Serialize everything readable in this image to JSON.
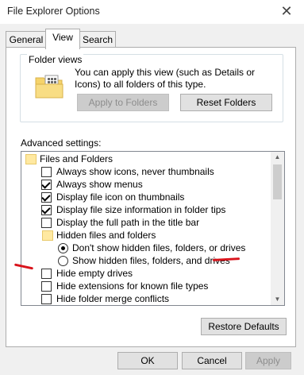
{
  "window": {
    "title": "File Explorer Options",
    "close_symbol": "✕"
  },
  "tabs": [
    {
      "label": "General",
      "selected": false
    },
    {
      "label": "View",
      "selected": true
    },
    {
      "label": "Search",
      "selected": false
    }
  ],
  "folder_views": {
    "group_label": "Folder views",
    "description": "You can apply this view (such as Details or Icons) to all folders of this type.",
    "apply_button": "Apply to Folders",
    "reset_button": "Reset Folders",
    "icon": "folder-view-icon"
  },
  "advanced": {
    "label": "Advanced settings:",
    "items": [
      {
        "type": "folder",
        "label": "Files and Folders"
      },
      {
        "type": "checkbox",
        "label": "Always show icons, never thumbnails",
        "checked": false
      },
      {
        "type": "checkbox",
        "label": "Always show menus",
        "checked": true
      },
      {
        "type": "checkbox",
        "label": "Display file icon on thumbnails",
        "checked": true
      },
      {
        "type": "checkbox",
        "label": "Display file size information in folder tips",
        "checked": true
      },
      {
        "type": "checkbox",
        "label": "Display the full path in the title bar",
        "checked": false
      },
      {
        "type": "folder",
        "label": "Hidden files and folders"
      },
      {
        "type": "radio",
        "label": "Don't show hidden files, folders, or drives",
        "selected": true
      },
      {
        "type": "radio",
        "label": "Show hidden files, folders, and drives",
        "selected": false
      },
      {
        "type": "checkbox",
        "label": "Hide empty drives",
        "checked": false
      },
      {
        "type": "checkbox",
        "label": "Hide extensions for known file types",
        "checked": false
      },
      {
        "type": "checkbox",
        "label": "Hide folder merge conflicts",
        "checked": false
      }
    ]
  },
  "restore_defaults_button": "Restore Defaults",
  "footer": {
    "ok": "OK",
    "cancel": "Cancel",
    "apply": "Apply"
  },
  "scroll": {
    "up_symbol": "▲",
    "down_symbol": "▼"
  },
  "colors": {
    "annotation": "#d9141c",
    "accent": "#0078d7"
  }
}
